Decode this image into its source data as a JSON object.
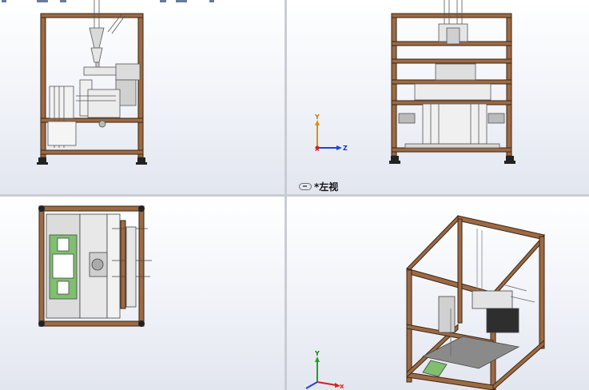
{
  "viewports": {
    "front": {
      "name": "front-view"
    },
    "left": {
      "name": "left-view",
      "label": "*左视"
    },
    "top": {
      "name": "top-view"
    },
    "iso": {
      "name": "isometric-view"
    }
  },
  "triad": {
    "x": "X",
    "y": "Y",
    "z": "Z"
  },
  "colors": {
    "frame": "#8a5a3a",
    "frame_dark": "#4a2c18",
    "green_part": "#7fbf6f",
    "steel": "#9aa0a8",
    "background_top": "#ffffff",
    "background_bottom": "#e2e6ef",
    "axis_x": "#d42020",
    "axis_y": "#d8901c",
    "axis_z": "#2040d8",
    "axis_y_iso": "#2a9a2a"
  },
  "icons": {
    "view_link": "view-link-icon",
    "triad": "coordinate-triad-icon"
  }
}
